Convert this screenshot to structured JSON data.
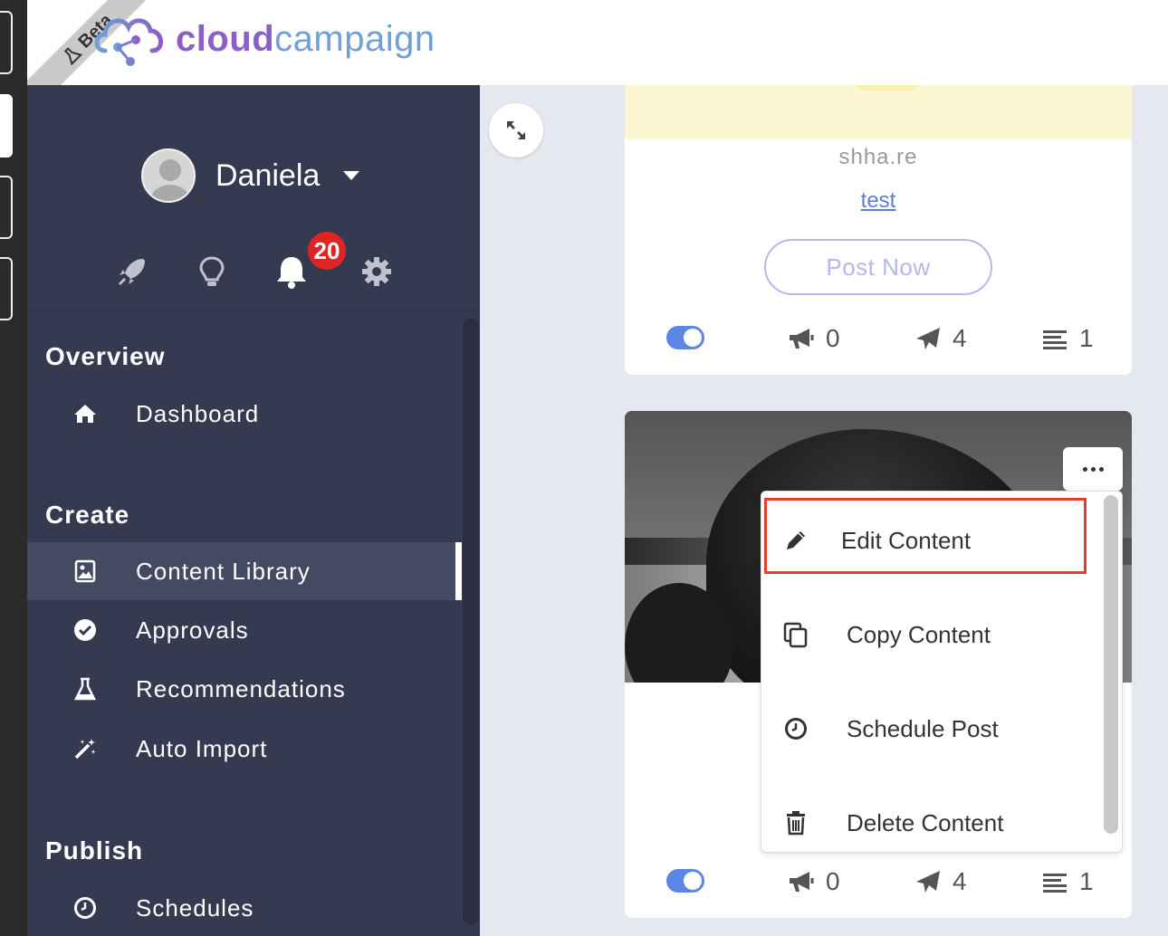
{
  "header": {
    "beta_label": "Beta",
    "logo_part1": "cloud",
    "logo_part2": "campaign"
  },
  "user": {
    "name": "Daniela",
    "notification_count": "20"
  },
  "sidebar": {
    "sections": [
      {
        "title": "Overview",
        "items": [
          {
            "label": "Dashboard",
            "icon": "home-icon"
          }
        ]
      },
      {
        "title": "Create",
        "items": [
          {
            "label": "Content Library",
            "icon": "image-icon",
            "active": true
          },
          {
            "label": "Approvals",
            "icon": "check-circle-icon"
          },
          {
            "label": "Recommendations",
            "icon": "flask-icon"
          },
          {
            "label": "Auto Import",
            "icon": "magic-wand-icon"
          }
        ]
      },
      {
        "title": "Publish",
        "items": [
          {
            "label": "Schedules",
            "icon": "clock-icon"
          }
        ]
      }
    ]
  },
  "card1": {
    "domain": "shha.re",
    "link_text": "test",
    "post_now_label": "Post Now",
    "stats": {
      "campaigns": "0",
      "sends": "4",
      "lists": "1"
    }
  },
  "card2": {
    "stats": {
      "campaigns": "0",
      "sends": "4",
      "lists": "1"
    }
  },
  "menu": {
    "items": [
      {
        "label": "Edit Content",
        "icon": "pencil-icon"
      },
      {
        "label": "Copy Content",
        "icon": "copy-icon"
      },
      {
        "label": "Schedule Post",
        "icon": "clock-icon"
      },
      {
        "label": "Delete Content",
        "icon": "trash-icon"
      }
    ]
  },
  "colors": {
    "sidebar_bg": "#363a50",
    "accent_blue": "#5b86e5",
    "badge_red": "#e02424",
    "highlight_red": "#e0402a",
    "logo_purple": "#8b5fc6",
    "logo_blue": "#6fa0d8"
  }
}
